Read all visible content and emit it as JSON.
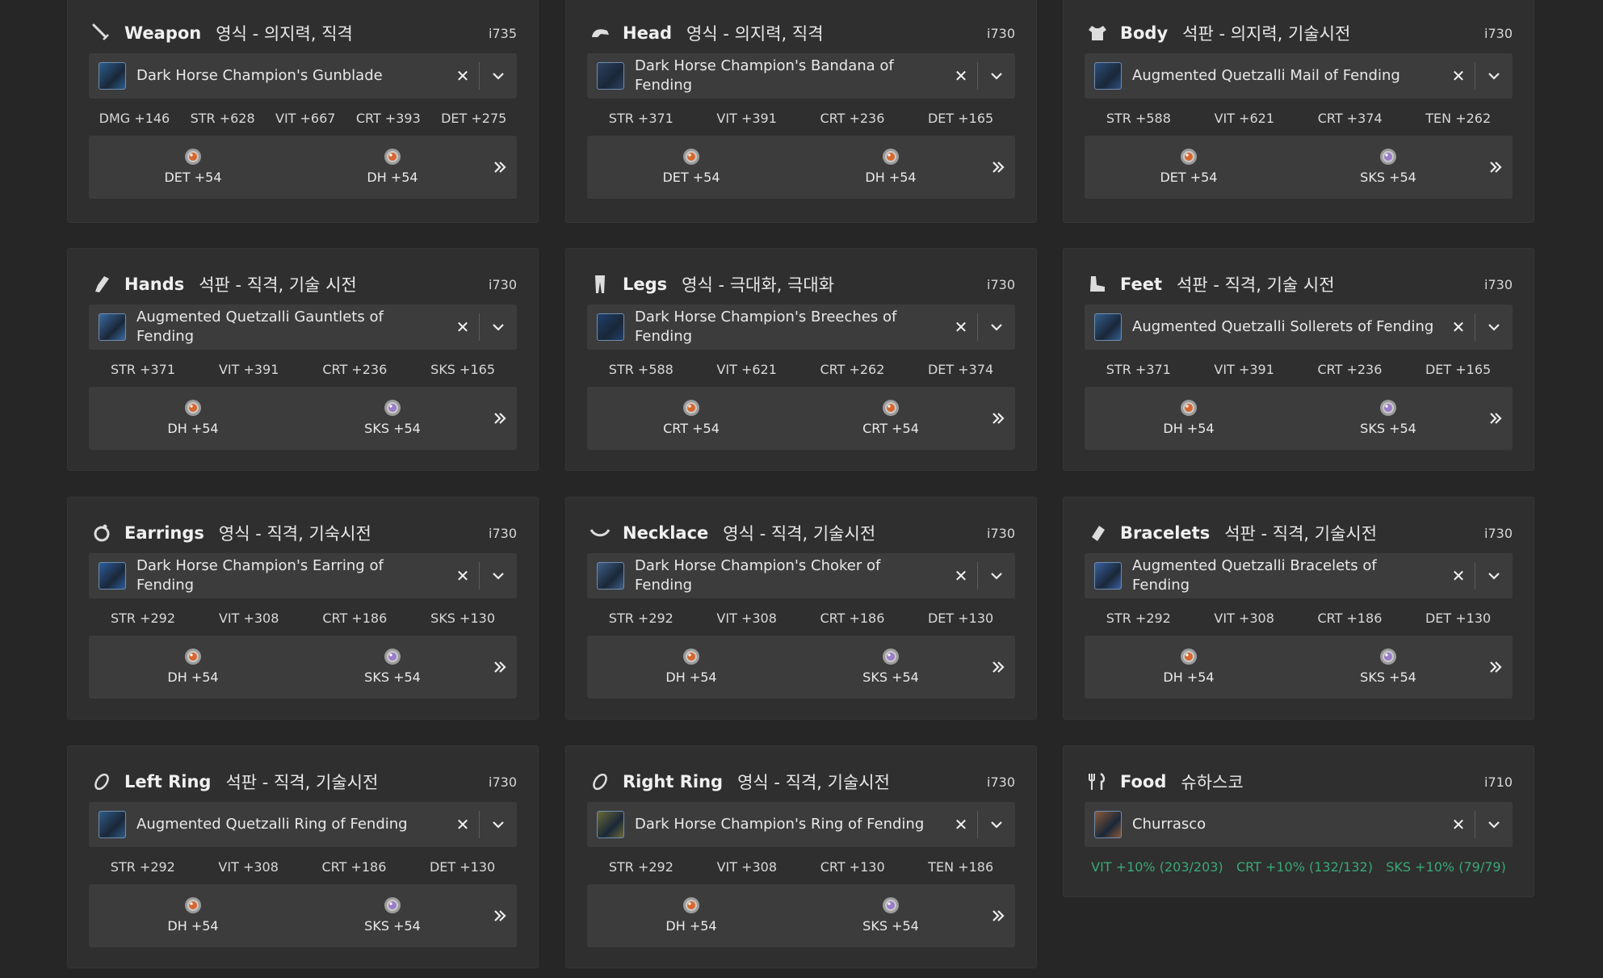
{
  "slots": [
    {
      "name": "Weapon",
      "sub": "영식 - 의지력, 직격",
      "ilvl": "i735",
      "icon": "sword-icon",
      "item": "Dark Horse Champion's Gunblade",
      "thumb": "#2a5e8e",
      "stats": [
        "DMG +146",
        "STR +628",
        "VIT +667",
        "CRT +393",
        "DET +275"
      ],
      "melds": [
        {
          "label": "DET +54",
          "materia": "orange"
        },
        {
          "label": "DH +54",
          "materia": "orange"
        }
      ]
    },
    {
      "name": "Head",
      "sub": "영식 - 의지력, 직격",
      "ilvl": "i730",
      "icon": "helmet-icon",
      "item": "Dark Horse Champion's Bandana of Fending",
      "thumb": "#2c4260",
      "stats": [
        "STR +371",
        "VIT +391",
        "CRT +236",
        "DET +165"
      ],
      "melds": [
        {
          "label": "DET +54",
          "materia": "orange"
        },
        {
          "label": "DH +54",
          "materia": "orange"
        }
      ]
    },
    {
      "name": "Body",
      "sub": "석판 - 의지력, 기술시전",
      "ilvl": "i730",
      "icon": "chest-armor-icon",
      "item": "Augmented Quetzalli Mail of Fending",
      "thumb": "#2c4f7a",
      "stats": [
        "STR +588",
        "VIT +621",
        "CRT +374",
        "TEN +262"
      ],
      "melds": [
        {
          "label": "DET +54",
          "materia": "orange"
        },
        {
          "label": "SKS +54",
          "materia": "purple"
        }
      ]
    },
    {
      "name": "Hands",
      "sub": "석판 - 직격, 기술 시전",
      "ilvl": "i730",
      "icon": "gauntlet-icon",
      "item": "Augmented Quetzalli Gauntlets of Fending",
      "thumb": "#3b6aa0",
      "stats": [
        "STR +371",
        "VIT +391",
        "CRT +236",
        "SKS +165"
      ],
      "melds": [
        {
          "label": "DH +54",
          "materia": "orange"
        },
        {
          "label": "SKS +54",
          "materia": "purple"
        }
      ]
    },
    {
      "name": "Legs",
      "sub": "영식 - 극대화, 극대화",
      "ilvl": "i730",
      "icon": "legs-icon",
      "item": "Dark Horse Champion's Breeches of Fending",
      "thumb": "#1f3f6c",
      "stats": [
        "STR +588",
        "VIT +621",
        "CRT +262",
        "DET +374"
      ],
      "melds": [
        {
          "label": "CRT +54",
          "materia": "orange"
        },
        {
          "label": "CRT +54",
          "materia": "orange"
        }
      ]
    },
    {
      "name": "Feet",
      "sub": "석판 - 직격, 기술 시전",
      "ilvl": "i730",
      "icon": "boot-icon",
      "item": "Augmented Quetzalli Sollerets of Fending",
      "thumb": "#345e8e",
      "stats": [
        "STR +371",
        "VIT +391",
        "CRT +236",
        "DET +165"
      ],
      "melds": [
        {
          "label": "DH +54",
          "materia": "orange"
        },
        {
          "label": "SKS +54",
          "materia": "purple"
        }
      ]
    },
    {
      "name": "Earrings",
      "sub": "영식 - 직격, 기숙시전",
      "ilvl": "i730",
      "icon": "earring-icon",
      "item": "Dark Horse Champion's Earring of Fending",
      "thumb": "#2b5d9a",
      "stats": [
        "STR +292",
        "VIT +308",
        "CRT +186",
        "SKS +130"
      ],
      "melds": [
        {
          "label": "DH +54",
          "materia": "orange"
        },
        {
          "label": "SKS +54",
          "materia": "purple"
        }
      ]
    },
    {
      "name": "Necklace",
      "sub": "영식 - 직격, 기술시전",
      "ilvl": "i730",
      "icon": "necklace-icon",
      "item": "Dark Horse Champion's Choker of Fending",
      "thumb": "#3f5f86",
      "stats": [
        "STR +292",
        "VIT +308",
        "CRT +186",
        "DET +130"
      ],
      "melds": [
        {
          "label": "DH +54",
          "materia": "orange"
        },
        {
          "label": "SKS +54",
          "materia": "purple"
        }
      ]
    },
    {
      "name": "Bracelets",
      "sub": "석판 - 직격, 기술시전",
      "ilvl": "i730",
      "icon": "bracelet-icon",
      "item": "Augmented Quetzalli Bracelets of Fending",
      "thumb": "#3a5f9e",
      "stats": [
        "STR +292",
        "VIT +308",
        "CRT +186",
        "DET +130"
      ],
      "melds": [
        {
          "label": "DH +54",
          "materia": "orange"
        },
        {
          "label": "SKS +54",
          "materia": "purple"
        }
      ]
    },
    {
      "name": "Left Ring",
      "sub": "석판 - 직격, 기술시전",
      "ilvl": "i730",
      "icon": "ring-icon",
      "item": "Augmented Quetzalli Ring of Fending",
      "thumb": "#2f5a86",
      "stats": [
        "STR +292",
        "VIT +308",
        "CRT +186",
        "DET +130"
      ],
      "melds": [
        {
          "label": "DH +54",
          "materia": "orange"
        },
        {
          "label": "SKS +54",
          "materia": "purple"
        }
      ]
    },
    {
      "name": "Right Ring",
      "sub": "영식 - 직격, 기술시전",
      "ilvl": "i730",
      "icon": "ring-icon",
      "item": "Dark Horse Champion's Ring of Fending",
      "thumb": "#6a6a3a",
      "stats": [
        "STR +292",
        "VIT +308",
        "CRT +130",
        "TEN +186"
      ],
      "melds": [
        {
          "label": "DH +54",
          "materia": "orange"
        },
        {
          "label": "SKS +54",
          "materia": "purple"
        }
      ]
    }
  ],
  "food": {
    "name": "Food",
    "sub": "슈하스코",
    "ilvl": "i710",
    "icon": "fork-knife-icon",
    "item": "Churrasco",
    "thumb": "#8a5a3a",
    "stats": [
      "VIT +10% (203/203)",
      "CRT +10% (132/132)",
      "SKS +10% (79/79)"
    ],
    "stat_color": "#3aa876"
  },
  "colors": {
    "background": "#262626",
    "card": "#2f2f2f",
    "row": "#3c3c3c"
  }
}
